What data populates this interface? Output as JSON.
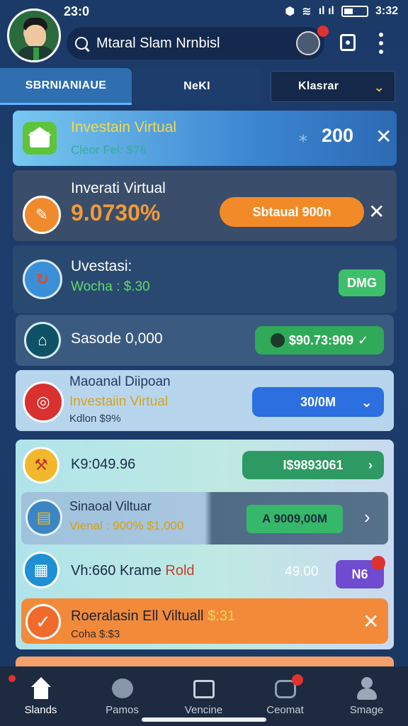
{
  "status": {
    "time": "23:0",
    "right_time": "3:32"
  },
  "header": {
    "search_text": "Mtaral Slam Nrnbisl"
  },
  "tabs": [
    {
      "label": "SBRNIANIAUE"
    },
    {
      "label": "NeKI"
    },
    {
      "label": "Klasrar"
    }
  ],
  "cards": [
    {
      "title": "Investain Virtual",
      "sub": "Cleor Fel: $76",
      "value": "200",
      "value_symbol": "⁎"
    },
    {
      "title": "Inverati Virtual",
      "sub": "9.0730%",
      "button": "Sbtaual 900n"
    },
    {
      "title": "Uvestasi:",
      "sub": "Wocha : $.30",
      "button": "DMG"
    },
    {
      "title": "Sasode 0,000",
      "button": "$90.73:909"
    },
    {
      "title": "Maoanal Diipoan",
      "sub": "Investaiin Virtual",
      "sub2": "Kdlon $9%",
      "button": "30/0M"
    },
    {
      "title": "K9:049.96",
      "button": "I$9893061"
    },
    {
      "title": "Sinaoal Viltuar",
      "sub": "Vienal : 900% $1,000",
      "button": "A 9009,00M"
    },
    {
      "title": "Vh:660 Krame",
      "title_extra": "Rold",
      "value": "49.00",
      "button": "N6"
    },
    {
      "title": "Roeralasin Ell Viltuall",
      "title_extra": "$:31",
      "sub": "Coha $:$3"
    }
  ],
  "nav": [
    {
      "label": "Slands"
    },
    {
      "label": "Pamos"
    },
    {
      "label": "Vencine"
    },
    {
      "label": "Ceomat"
    },
    {
      "label": "Smage"
    }
  ],
  "colors": {
    "bg": "#1b3a68",
    "green": "#2ea043",
    "orange": "#f38a2c",
    "blue": "#2d6fe0",
    "purple": "#6c4ccf"
  }
}
